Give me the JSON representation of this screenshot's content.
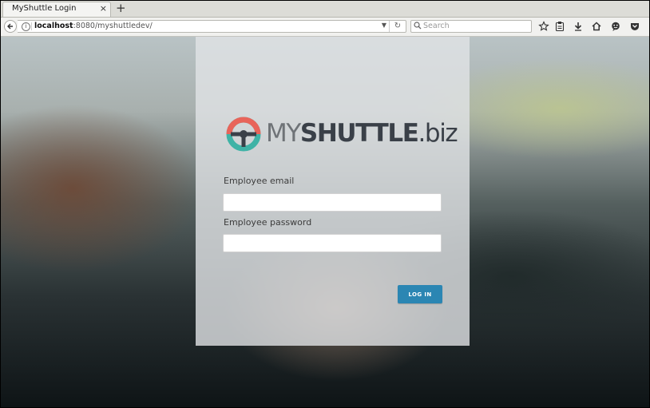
{
  "browser": {
    "tab": {
      "title": "MyShuttle Login",
      "close_symbol": "×"
    },
    "new_tab_symbol": "+",
    "url": {
      "host": "localhost",
      "rest": ":8080/myshuttledev/"
    },
    "search": {
      "placeholder": "Search"
    }
  },
  "page": {
    "logo": {
      "my": "MY",
      "shuttle": "SHUTTLE",
      "biz": ".biz"
    },
    "email_label": "Employee email",
    "password_label": "Employee password",
    "login_label": "LOG IN"
  },
  "colors": {
    "logo_red": "#e8645a",
    "logo_teal": "#3fb3a6",
    "logo_dark": "#3a4048",
    "button_blue": "#2b86b3"
  }
}
